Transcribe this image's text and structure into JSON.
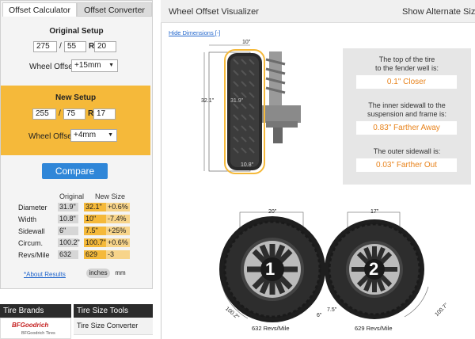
{
  "tabs": {
    "calculator": "Offset Calculator",
    "converter": "Offset Converter"
  },
  "original": {
    "title": "Original Setup",
    "width": "275",
    "aspect": "55",
    "rim": "20",
    "slash": "/",
    "r": "R",
    "offset_label": "Wheel Offset",
    "offset": "+15mm"
  },
  "new_setup": {
    "title": "New Setup",
    "width": "255",
    "aspect": "75",
    "rim": "17",
    "slash": "/",
    "r": "R",
    "offset_label": "Wheel Offset",
    "offset": "+4mm"
  },
  "compare_label": "Compare",
  "table": {
    "headers": {
      "original": "Original",
      "new": "New Size"
    },
    "rows": [
      {
        "label": "Diameter",
        "orig": "31.9\"",
        "new": "32.1\"",
        "diff": "+0.6%"
      },
      {
        "label": "Width",
        "orig": "10.8\"",
        "new": "10\"",
        "diff": "-7.4%"
      },
      {
        "label": "Sidewall",
        "orig": "6\"",
        "new": "7.5\"",
        "diff": "+25%"
      },
      {
        "label": "Circum.",
        "orig": "100.2\"",
        "new": "100.7\"",
        "diff": "+0.6%"
      },
      {
        "label": "Revs/Mile",
        "orig": "632",
        "new": "629",
        "diff": "-3"
      }
    ]
  },
  "about_link": "*About Results",
  "units": {
    "inches": "inches",
    "mm": "mm"
  },
  "brands": {
    "title": "Tire Brands",
    "logo": "BFGoodrich",
    "caption": "BFGoodrich Tires"
  },
  "tools": {
    "title": "Tire Size Tools",
    "item": "Tire Size Converter"
  },
  "visualizer": {
    "title": "Wheel Offset Visualizer",
    "alt": "Show Alternate Sizes [-",
    "hide_dims": "Hide Dimensions [-]",
    "dim_top": "10\"",
    "dim_side": "32.1\"",
    "dim_inner": "31.9\"",
    "dim_bottom": "10.8\"",
    "facts": [
      {
        "text1": "The top of the tire",
        "text2": "to the fender well is:",
        "value": "0.1\" Closer"
      },
      {
        "text1": "The inner sidewall to the",
        "text2": "suspension and frame is:",
        "value": "0.83\" Farther Away"
      },
      {
        "text1": "The outer sidewall is:",
        "text2": "",
        "value": "0.03\" Farther Out"
      }
    ]
  },
  "tire1": {
    "width_label": "20\"",
    "number": "1",
    "diag": "100.2\"",
    "side": "6\"",
    "revs": "632 Revs/Mile"
  },
  "tire2": {
    "width_label": "17\"",
    "number": "2",
    "diag": "100.7\"",
    "side": "7.5\"",
    "revs": "629 Revs/Mile"
  },
  "colors": {
    "accent": "#f5b93a",
    "button": "#2f86d8",
    "highlight": "#e8831c",
    "dark": "#2b2b2b"
  }
}
